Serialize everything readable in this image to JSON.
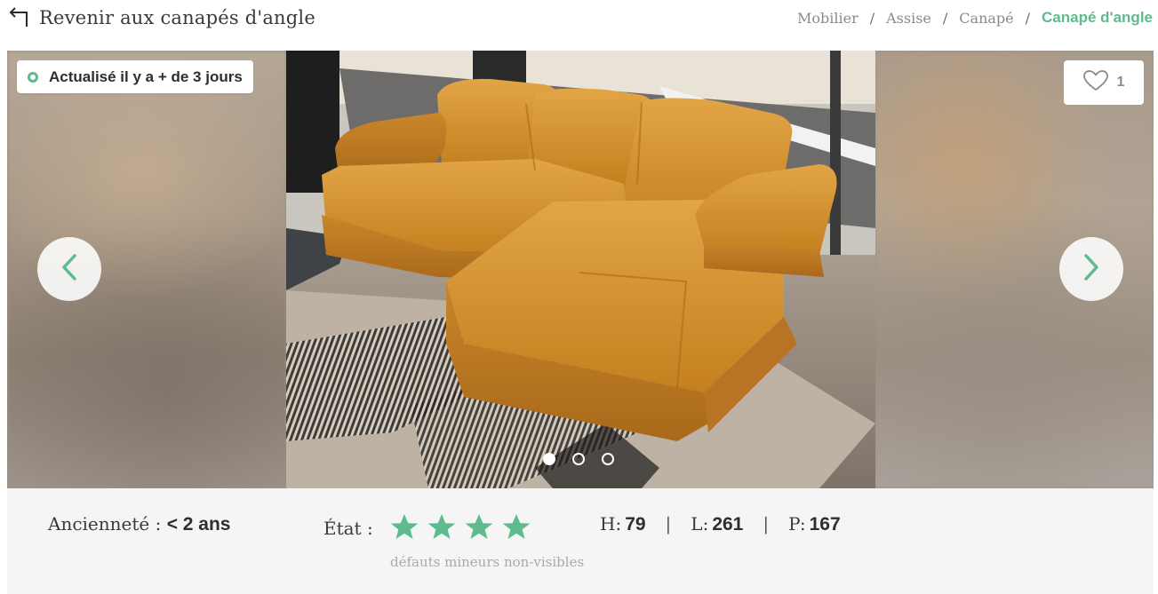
{
  "header": {
    "back_label": "Revenir aux canapés d'angle",
    "breadcrumb": [
      "Mobilier",
      "Assise",
      "Canapé"
    ],
    "breadcrumb_current": "Canapé d'angle",
    "separator": "/"
  },
  "gallery": {
    "update_badge": "Actualisé il y a + de 3 jours",
    "likes": "1",
    "slides_total": 3,
    "active_slide": 1
  },
  "specs": {
    "age_label": "Ancienneté :",
    "age_value": "< 2 ans",
    "state_label": "État :",
    "stars": 4,
    "state_desc": "défauts mineurs non-visibles",
    "height_label": "H:",
    "height_value": "79",
    "length_label": "L:",
    "length_value": "261",
    "depth_label": "P:",
    "depth_value": "167",
    "divider": "|"
  },
  "colors": {
    "accent": "#5dbb8e",
    "text": "#3a3a3a",
    "muted": "#8a8a8a",
    "specs_bg": "#f5f5f5",
    "sofa_leather": "#d9962f"
  },
  "icons": {
    "back": "return-arrow-icon",
    "like": "heart-icon",
    "prev": "chevron-left-icon",
    "next": "chevron-right-icon",
    "star": "star-icon",
    "status": "circle-status-icon"
  }
}
